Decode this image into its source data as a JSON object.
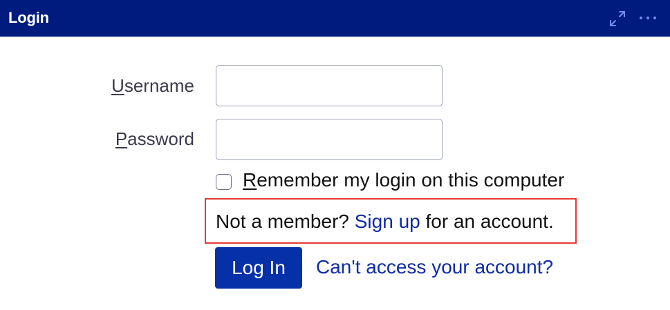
{
  "dialog": {
    "title": "Login",
    "icons": {
      "expand": "expand-icon",
      "more": "more-options-icon"
    }
  },
  "form": {
    "username": {
      "label_key": "U",
      "label_rest": "sername",
      "value": ""
    },
    "password": {
      "label_key": "P",
      "label_rest": "assword",
      "value": ""
    },
    "remember": {
      "label_key": "R",
      "label_rest": "emember my login on this computer",
      "checked": false
    },
    "signup": {
      "prefix": "Not a member? ",
      "link": "Sign up",
      "suffix": " for an account."
    },
    "login_button": "Log In",
    "access_link": "Can't access your account?"
  },
  "colors": {
    "header": "#001b7e",
    "primary_button": "#0530a8",
    "link": "#0d2aa6",
    "highlight_border": "#e53935"
  }
}
